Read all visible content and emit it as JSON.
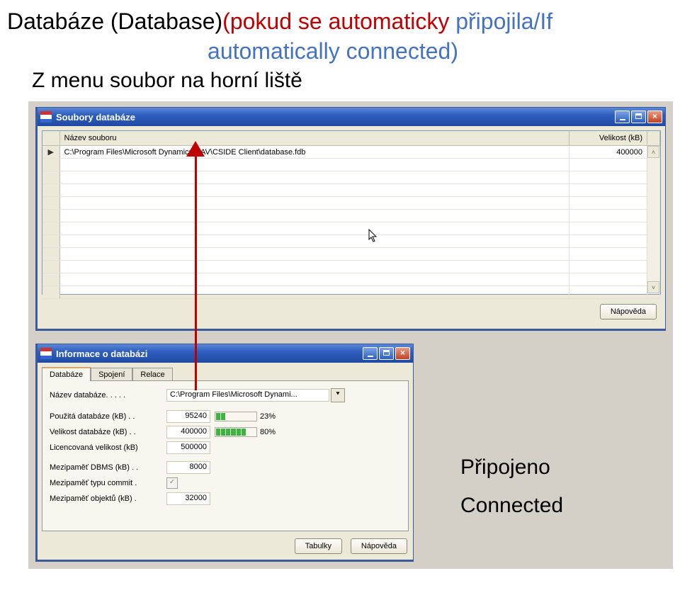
{
  "heading": {
    "part_black": "Databáze (Database)",
    "part_red": "(pokud se automaticky ",
    "part_blue_end": "připojila/If",
    "line2_blue": "automatically connected)"
  },
  "subheading": "Z menu soubor na horní liště",
  "win1": {
    "title": "Soubory databáze",
    "columns": {
      "file": "Název souboru",
      "size": "Velikost (kB)"
    },
    "rows": [
      {
        "marker": "▶",
        "file": "C:\\Program Files\\Microsoft Dynamics NAV\\CSIDE Client\\database.fdb",
        "size": "400000"
      }
    ],
    "scroll": {
      "up": "˄",
      "down": "˅"
    },
    "help_button": "Nápověda"
  },
  "win2": {
    "title": "Informace o databázi",
    "tabs": {
      "db": "Databáze",
      "conn": "Spojení",
      "rel": "Relace"
    },
    "fields": {
      "name_label": "Název databáze. . . . .",
      "name_value": "C:\\Program Files\\Microsoft Dynami...",
      "drop_glyph": "⯆",
      "used_label": "Použitá databáze (kB) . .",
      "used_value": "95240",
      "used_pct": "23%",
      "size_label": "Velikost databáze (kB) . .",
      "size_value": "400000",
      "size_pct": "80%",
      "lic_label": "Licencovaná velikost (kB)",
      "lic_value": "500000",
      "dbms_label": "Mezipaměť DBMS (kB) . .",
      "dbms_value": "8000",
      "commit_label": "Mezipaměť typu commit .",
      "commit_check": "✓",
      "obj_label": "Mezipaměť objektů (kB) .",
      "obj_value": "32000"
    },
    "tables_button": "Tabulky",
    "help_button": "Nápověda"
  },
  "win_controls": {
    "close_glyph": "×"
  },
  "side": {
    "pripojeno": "Připojeno",
    "connected": "Connected"
  }
}
